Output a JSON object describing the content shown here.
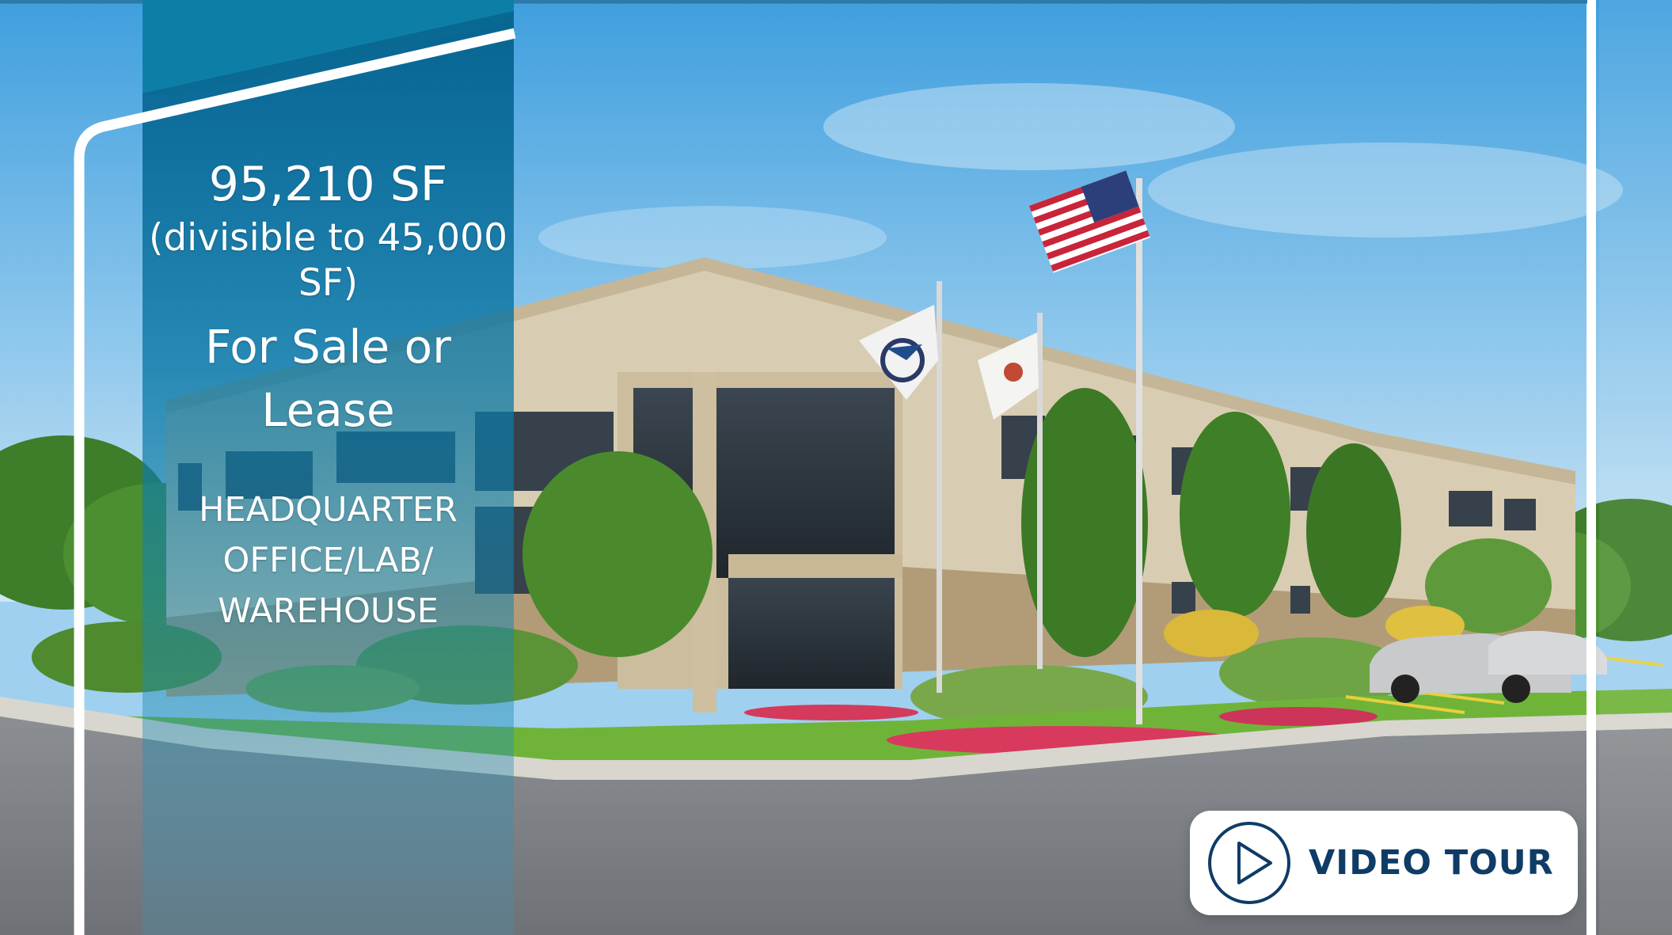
{
  "headline": {
    "size": "95,210 SF",
    "divisible": "(divisible to 45,000 SF)",
    "offer": "For Sale or Lease",
    "property_type": "HEADQUARTER OFFICE/LAB/ WAREHOUSE"
  },
  "video_button": {
    "label": "VIDEO TOUR",
    "icon": "play-icon"
  },
  "colors": {
    "panel_blue": "#04608c",
    "button_text": "#0f3c66",
    "frame": "#ffffff"
  }
}
